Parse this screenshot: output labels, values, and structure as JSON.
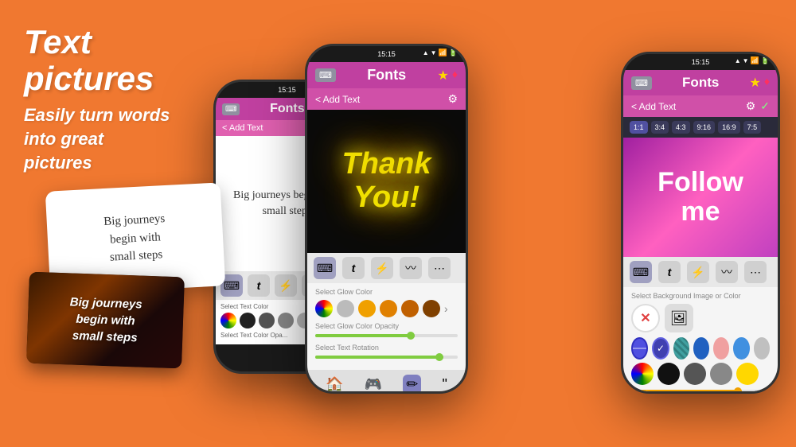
{
  "background_color": "#F07830",
  "hero": {
    "title": "Text pictures",
    "subtitle_line1": "Easily turn words",
    "subtitle_line2": "into great",
    "subtitle_line3": "pictures"
  },
  "phone_left": {
    "status_time": "15:15",
    "fonts_label": "Fonts",
    "add_text_label": "< Add Text",
    "canvas_text": "Big journeys begin with small steps",
    "color_label": "Select Text Color",
    "color_opacity_label": "Select Text Color Opa..."
  },
  "phone_center": {
    "status_time": "15:15",
    "fonts_label": "Fonts",
    "add_text_label": "< Add Text",
    "thank_you_text_line1": "Thank",
    "thank_you_text_line2": "You!",
    "glow_color_label": "Select Glow Color",
    "glow_opacity_label": "Select Glow Color Opacity",
    "rotation_label": "Select Text Rotation"
  },
  "phone_right": {
    "status_time": "15:15",
    "fonts_label": "Fonts",
    "add_text_label": "< Add Text",
    "follow_text_line1": "Follow",
    "follow_text_line2": "me",
    "ratios": [
      "1:1",
      "3:4",
      "4:3",
      "9:16",
      "16:9",
      "7:5"
    ],
    "bg_label": "Select Background Image or Color"
  },
  "card_white": {
    "text": "Big journeys\nbegin with\nsmall steps"
  },
  "card_dark": {
    "text": "Big journeys\nbegin with\nsmall steps"
  }
}
